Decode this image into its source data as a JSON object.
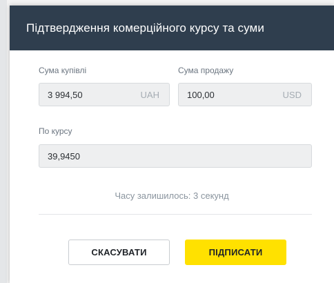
{
  "modal": {
    "title": "Підтвердження комерційного курсу та суми"
  },
  "purchase": {
    "label": "Сума купівлі",
    "value": "3 994,50",
    "currency": "UAH"
  },
  "sale": {
    "label": "Сума продажу",
    "value": "100,00",
    "currency": "USD"
  },
  "rate": {
    "label": "По курсу",
    "value": "39,9450"
  },
  "timer": {
    "text": "Часу залишилось: 3 секунд"
  },
  "actions": {
    "cancel_label": "СКАСУВАТИ",
    "sign_label": "ПІДПИСАТИ"
  },
  "colors": {
    "header_bg": "#2f3e4e",
    "sign_button": "#ffe100"
  }
}
